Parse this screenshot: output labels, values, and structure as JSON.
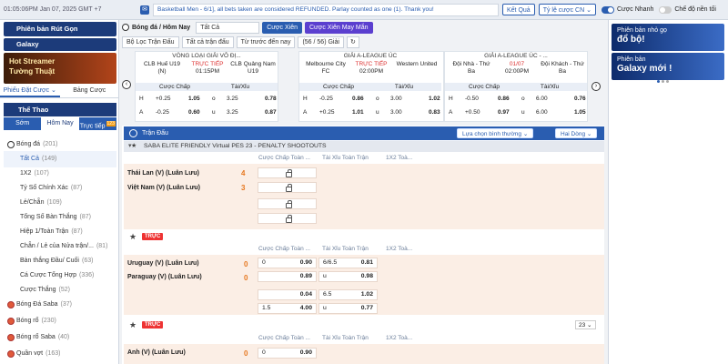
{
  "topbar": {
    "clock": "01:05:06PM Jan 07, 2025 GMT +7",
    "news": "Basketball Men - 6/1], all bets taken are considered REFUNDED. Parlay counted as one (1). Thank you!",
    "result_btn": "Kết Quả",
    "odds_btn": "Tỷ lệ cược CN ⌄",
    "quick_bet": "Cược Nhanh",
    "background_mode": "Chế độ nền tối"
  },
  "left": {
    "banner1": "Phiên bản Rút Gọn",
    "banner2": "Galaxy",
    "banner3_l1": "Hot Streamer",
    "banner3_l2": "Tường Thuật",
    "tabs": [
      "Phiếu Đặt Cược ⌄",
      "Bảng Cược"
    ],
    "sport_header": "Thể Thao",
    "subtabs": [
      "Sớm",
      "Hôm Nay",
      "Trực tiếp"
    ],
    "live_count": "123",
    "rows": [
      {
        "label": "Bóng đá",
        "count": "(201)",
        "kind": "top"
      },
      {
        "label": "Tất Cả",
        "count": "(149)",
        "kind": "sub act"
      },
      {
        "label": "1X2",
        "count": "(107)",
        "kind": "sub"
      },
      {
        "label": "Tỷ Số Chính Xác",
        "count": "(87)",
        "kind": "sub"
      },
      {
        "label": "Lẻ/Chẵn",
        "count": "(109)",
        "kind": "sub"
      },
      {
        "label": "Tổng Số Bàn Thắng",
        "count": "(87)",
        "kind": "sub"
      },
      {
        "label": "Hiệp 1/Toàn Trận",
        "count": "(87)",
        "kind": "sub"
      },
      {
        "label": "Chẵn / Lẻ của Nửa trận/...",
        "count": "(81)",
        "kind": "sub"
      },
      {
        "label": "Bàn thắng Đầu/ Cuối",
        "count": "(63)",
        "kind": "sub"
      },
      {
        "label": "Cá Cược Tổng Hợp",
        "count": "(336)",
        "kind": "sub"
      },
      {
        "label": "Cược Thắng",
        "count": "(52)",
        "kind": "sub"
      },
      {
        "label": "Bóng Đá Saba",
        "count": "(37)",
        "kind": "top"
      },
      {
        "label": "Bóng rổ",
        "count": "(230)",
        "kind": "top"
      },
      {
        "label": "Bóng rổ Saba",
        "count": "(40)",
        "kind": "top"
      },
      {
        "label": "Quần vợt",
        "count": "(163)",
        "kind": "top"
      }
    ]
  },
  "controls": {
    "sport_label": "Bóng đá / Hôm Nay",
    "filter_all": "Tất Cả",
    "bet_btn": "Cược Xiên",
    "lucky_btn": "Cược Xiên May Mắn",
    "league_filter": "Bộ Lọc Trận Đấu",
    "all_matches": "Tất cả trận đấu",
    "sort": "Từ trước đến nay",
    "count": "(56 / 56) Giải"
  },
  "cards": [
    {
      "league": "VÒNG LOẠI GIẢI VÔ ĐỊ...",
      "home": "CLB Huế U19 (N)",
      "away": "CLB Quảng Nam U19",
      "status": "TRỰC TIẾP",
      "time": "01:15PM",
      "rows": [
        [
          "H",
          "+0.25",
          "1.05",
          "o",
          "3.25",
          "0.78"
        ],
        [
          "A",
          "-0.25",
          "0.60",
          "u",
          "3.25",
          "0.87"
        ]
      ]
    },
    {
      "league": "GIẢI A-LEAGUE ÚC",
      "home": "Melbourne City FC",
      "away": "Western United",
      "status": "TRỰC TIẾP",
      "time": "02:00PM",
      "rows": [
        [
          "H",
          "-0.25",
          "0.86",
          "o",
          "3.00",
          "1.02"
        ],
        [
          "A",
          "+0.25",
          "1.01",
          "u",
          "3.00",
          "0.83"
        ]
      ]
    },
    {
      "league": "GIẢI A-LEAGUE ÚC - ...",
      "home": "Đội Nhà - Thứ Ba",
      "away": "Đội Khách - Thứ Ba",
      "status": "01/07",
      "time": "02:00PM",
      "rows": [
        [
          "H",
          "-0.50",
          "0.86",
          "o",
          "6.00",
          "0.76"
        ],
        [
          "A",
          "+0.50",
          "0.97",
          "u",
          "6.00",
          "1.05"
        ]
      ]
    }
  ],
  "card_headers": [
    "Cược Chấp",
    "Tài/Xỉu"
  ],
  "right": {
    "ban1_small": "Phiên bản nhỏ gọ",
    "ban1_big": "đổ bộ!",
    "ban2_small": "Phiên bản",
    "ban2_big": "Galaxy mới !"
  },
  "table": {
    "header": "Trận Đấu",
    "selector": "Lựa chọn bình thường ⌄",
    "lines": "Hai Dòng ⌄",
    "league1": "SABA ELITE FRIENDLY Virtual PES 23 - PENALTY SHOOTOUTS",
    "cols": [
      "Cược Chấp Toàn ...",
      "Tài Xỉu Toàn Trận",
      "1X2 Toà..."
    ],
    "m1": {
      "home": "Thái Lan (V) (Luân Lưu)",
      "away": "Việt Nam (V) (Luân Lưu)",
      "hs": "4",
      "as": "3"
    },
    "live": "TRỰC",
    "m2": {
      "home": "Uruguay (V) (Luân Lưu)",
      "away": "Paraguay (V) (Luân Lưu)",
      "hs": "0",
      "as": "0"
    },
    "m2_odds": [
      [
        "0",
        "0.90",
        "6/6.5",
        "0.81"
      ],
      [
        "",
        "0.89",
        "u",
        "0.98"
      ],
      [
        "",
        "0.04",
        "6.5",
        "1.02"
      ],
      [
        "1.5",
        "4.00",
        "u",
        "0.77"
      ]
    ],
    "page": "23",
    "m3": {
      "home": "Anh (V) (Luân Lưu)",
      "hs": "0"
    },
    "m3_odds": [
      "0",
      "0.90"
    ]
  }
}
